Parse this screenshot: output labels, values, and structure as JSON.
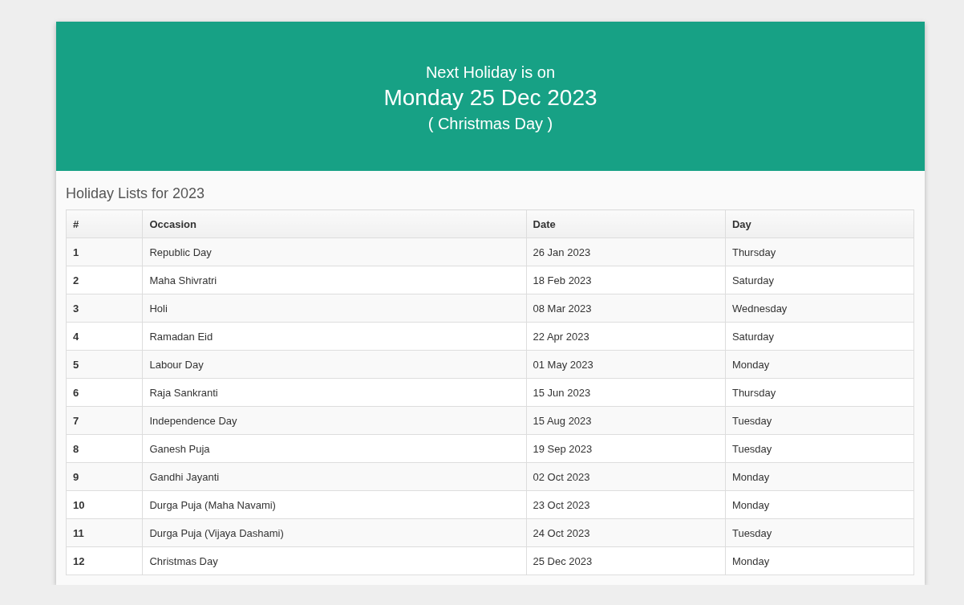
{
  "banner": {
    "lead": "Next Holiday is on",
    "date": "Monday 25 Dec 2023",
    "occasion": "( Christmas Day )"
  },
  "list_title": "Holiday Lists for 2023",
  "table": {
    "columns": [
      "#",
      "Occasion",
      "Date",
      "Day"
    ],
    "rows": [
      [
        "1",
        "Republic Day",
        "26 Jan 2023",
        "Thursday"
      ],
      [
        "2",
        "Maha Shivratri",
        "18 Feb 2023",
        "Saturday"
      ],
      [
        "3",
        "Holi",
        "08 Mar 2023",
        "Wednesday"
      ],
      [
        "4",
        "Ramadan Eid",
        "22 Apr 2023",
        "Saturday"
      ],
      [
        "5",
        "Labour Day",
        "01 May 2023",
        "Monday"
      ],
      [
        "6",
        "Raja Sankranti",
        "15 Jun 2023",
        "Thursday"
      ],
      [
        "7",
        "Independence Day",
        "15 Aug 2023",
        "Tuesday"
      ],
      [
        "8",
        "Ganesh Puja",
        "19 Sep 2023",
        "Tuesday"
      ],
      [
        "9",
        "Gandhi Jayanti",
        "02 Oct 2023",
        "Monday"
      ],
      [
        "10",
        "Durga Puja (Maha Navami)",
        "23 Oct 2023",
        "Monday"
      ],
      [
        "11",
        "Durga Puja (Vijaya Dashami)",
        "24 Oct 2023",
        "Tuesday"
      ],
      [
        "12",
        "Christmas Day",
        "25 Dec 2023",
        "Monday"
      ]
    ]
  }
}
